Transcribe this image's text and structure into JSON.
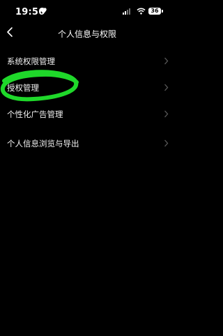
{
  "status_bar": {
    "time": "19:56",
    "battery": "36"
  },
  "header": {
    "title": "个人信息与权限"
  },
  "menu": {
    "items": [
      {
        "label": "系统权限管理"
      },
      {
        "label": "授权管理"
      },
      {
        "label": "个性化广告管理"
      },
      {
        "label": "个人信息浏览与导出"
      }
    ]
  },
  "annotation": {
    "color": "#1fd82a"
  }
}
